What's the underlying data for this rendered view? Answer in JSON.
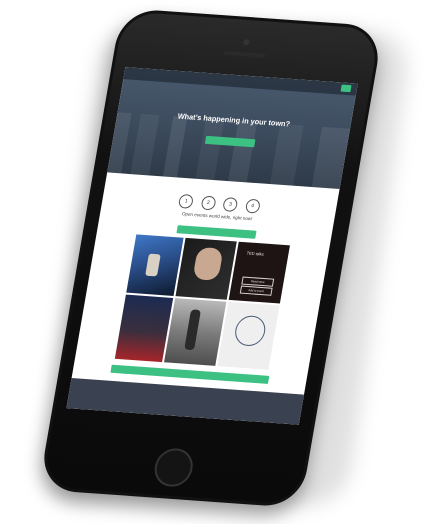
{
  "hero": {
    "logo": "",
    "nav": [
      "",
      ""
    ],
    "nav_cta": "",
    "title": "What's happening in your town?",
    "cta": ""
  },
  "steps": [
    "1",
    "2",
    "3",
    "4"
  ],
  "tagline": "Open events world wide, right now!",
  "grid_cta": "",
  "tiles": {
    "tedx_title": "TED talks",
    "tedx_sub": "",
    "btn1": "Read more",
    "btn2": "Add to event"
  },
  "bottom_cta": "",
  "colors": {
    "accent": "#3cc183",
    "hero": "#3b4a5c",
    "footer": "#3a4150",
    "phone": "#111111"
  }
}
